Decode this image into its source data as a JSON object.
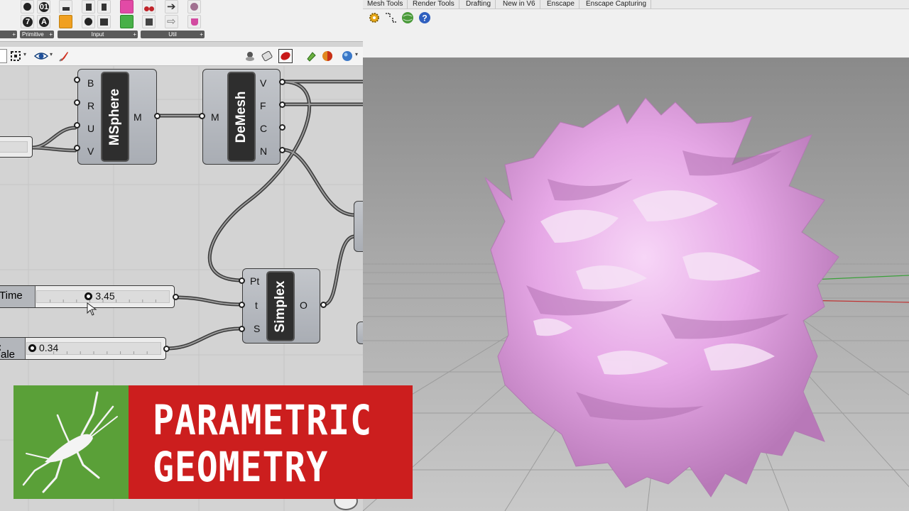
{
  "gh_ribbon": {
    "groups": [
      {
        "label": "",
        "plus": "+"
      },
      {
        "label": "Primitive",
        "plus": "+"
      },
      {
        "label": "Input",
        "plus": "+"
      },
      {
        "label": "Util",
        "plus": "+"
      }
    ],
    "glyphs": {
      "seven": "7",
      "a_letter": "A",
      "zero_one": "01"
    }
  },
  "components": {
    "msphere": {
      "name": "MSphere",
      "inputs": [
        "B",
        "R",
        "U",
        "V"
      ],
      "outputs": [
        "M"
      ]
    },
    "demesh": {
      "name": "DeMesh",
      "inputs": [
        "M"
      ],
      "outputs": [
        "V",
        "F",
        "C",
        "N"
      ]
    },
    "simplex": {
      "name": "Simplex",
      "inputs": [
        "Pt",
        "t",
        "S"
      ],
      "outputs": [
        "O"
      ]
    }
  },
  "sliders": {
    "time": {
      "label": "Time",
      "value": "3.45",
      "fraction": 0.38
    },
    "scale": {
      "label": "ale",
      "label_prefix": "c",
      "value": "0.34",
      "fraction": 0.0
    }
  },
  "rhino": {
    "tabs": [
      "Mesh Tools",
      "Render Tools",
      "Drafting",
      "New in V6",
      "Enscape",
      "Enscape Capturing"
    ]
  },
  "banner": {
    "line1": "PARAMETRIC",
    "line2": "GEOMETRY"
  },
  "colors": {
    "blob": "#e6a8e6",
    "banner_red": "#cc1e1e",
    "logo_green": "#5aa038"
  }
}
